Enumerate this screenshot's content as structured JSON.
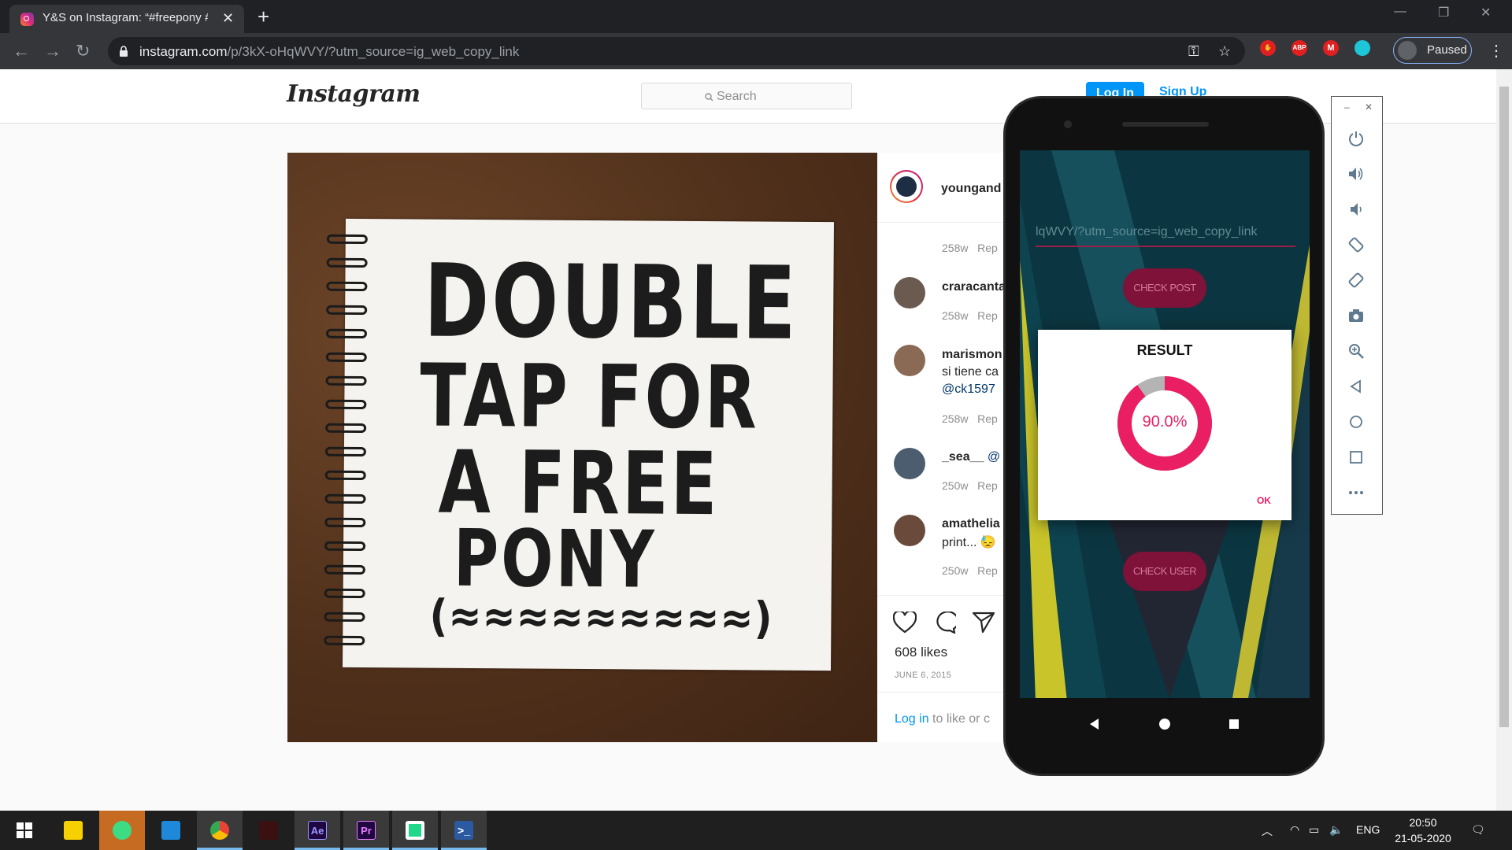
{
  "browser": {
    "tab_title": "Y&S on Instagram: “#freepony #c",
    "url_host": "instagram.com",
    "url_path": "/p/3kX-oHqWVY/?utm_source=ig_web_copy_link",
    "profile_label": "Paused",
    "extensions": [
      {
        "name": "shield-extension-icon",
        "color": "#e02020",
        "text": ""
      },
      {
        "name": "abp-extension-icon",
        "color": "#e02020",
        "text": "ABP"
      },
      {
        "name": "m-extension-icon",
        "color": "#e02020",
        "text": "M"
      },
      {
        "name": "teal-extension-icon",
        "color": "#1dc6d8",
        "text": ""
      }
    ]
  },
  "instagram": {
    "logo": "Instagram",
    "search_placeholder": "Search",
    "login_label": "Log In",
    "signup_label": "Sign Up",
    "post_image_text": [
      "DOUBLE",
      "TAP FOR",
      "A FREE",
      "PONY",
      "(≈≈≈≈≈≈≈≈≈)"
    ],
    "owner": "youngand",
    "comments": [
      {
        "user": "",
        "text": "",
        "meta": "258w",
        "reply": "Rep"
      },
      {
        "user": "craracanta",
        "text": "",
        "meta": "258w",
        "reply": "Rep"
      },
      {
        "user": "marismon",
        "text": "si tiene ca",
        "link": "@ck1597",
        "meta": "258w",
        "reply": "Rep"
      },
      {
        "user": "_sea__",
        "mention": "@",
        "meta": "250w",
        "reply": "Rep"
      },
      {
        "user": "amathelia",
        "text": "print... 😓",
        "meta": "250w",
        "reply": "Rep"
      }
    ],
    "likes": "608 likes",
    "date": "JUNE 6, 2015",
    "login_prompt_link": "Log in",
    "login_prompt_rest": " to like or c"
  },
  "emulator": {
    "url_value": "lqWVY/?utm_source=ig_web_copy_link",
    "check_post_label": "CHECK POST",
    "check_user_label": "CHECK USER",
    "dialog_title": "RESULT",
    "result_percent": 90.0,
    "result_label": "90.0%",
    "ok_label": "OK",
    "accent_color": "#e91e63",
    "panel_buttons": [
      "power-icon",
      "volume-up-icon",
      "volume-down-icon",
      "rotate-left-icon",
      "rotate-right-icon",
      "camera-icon",
      "zoom-icon",
      "back-icon",
      "home-icon",
      "overview-icon",
      "more-icon"
    ]
  },
  "taskbar": {
    "apps": [
      "windows-start-icon",
      "sticky-notes-icon",
      "android-studio-icon",
      "vscode-icon",
      "chrome-icon",
      "predator-icon",
      "after-effects-icon",
      "premiere-icon",
      "pycharm-icon",
      "powershell-icon"
    ],
    "ae_label": "Ae",
    "pr_label": "Pr",
    "language": "ENG",
    "time": "20:50",
    "date": "21-05-2020"
  }
}
